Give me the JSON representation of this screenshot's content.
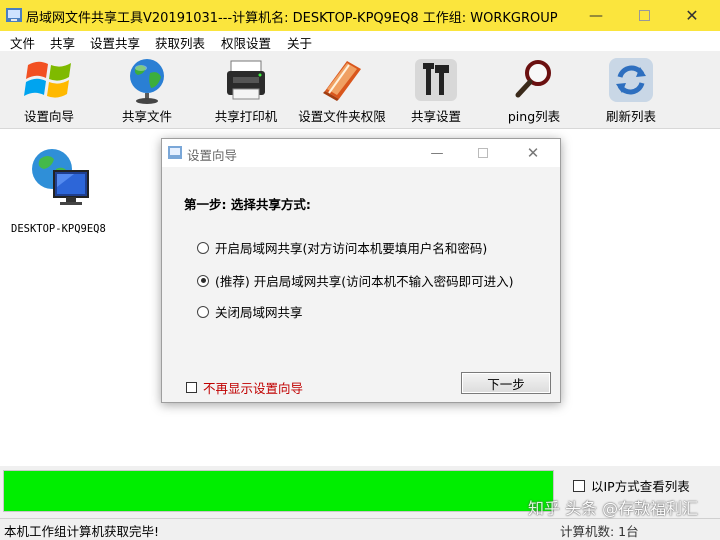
{
  "window": {
    "title": "局域网文件共享工具V20191031---计算机名: DESKTOP-KPQ9EQ8  工作组: WORKGROUP",
    "titlebar_color": "#fbe53d"
  },
  "menu": [
    "文件",
    "共享",
    "设置共享",
    "获取列表",
    "权限设置",
    "关于"
  ],
  "toolbar": [
    {
      "label": "设置向导",
      "icon": "windows-flag-icon"
    },
    {
      "label": "共享文件",
      "icon": "globe-icon"
    },
    {
      "label": "共享打印机",
      "icon": "printer-icon"
    },
    {
      "label": "设置文件夹权限",
      "icon": "folder-book-icon"
    },
    {
      "label": "共享设置",
      "icon": "tools-icon"
    },
    {
      "label": "ping列表",
      "icon": "magnifier-icon"
    },
    {
      "label": "刷新列表",
      "icon": "refresh-icon"
    }
  ],
  "computers": [
    {
      "name": "DESKTOP-KPQ9EQ8",
      "icon": "network-computer-icon"
    }
  ],
  "dialog": {
    "title": "设置向导",
    "heading": "第一步: 选择共享方式:",
    "options": [
      {
        "label": "开启局域网共享(对方访问本机要填用户名和密码)",
        "checked": false
      },
      {
        "label": "(推荐) 开启局域网共享(访问本机不输入密码即可进入)",
        "checked": true
      },
      {
        "label": "关闭局域网共享",
        "checked": false
      }
    ],
    "dont_show_label": "不再显示设置向导",
    "dont_show_checked": false,
    "next_button": "下一步"
  },
  "progress": {
    "value": 1.0,
    "color": "#00ee00"
  },
  "view_by_ip_label": "以IP方式查看列表",
  "status": {
    "left": "本机工作组计算机获取完毕!",
    "right": "计算机数: 1台"
  },
  "watermark": "知乎 头条 @存款福利汇"
}
